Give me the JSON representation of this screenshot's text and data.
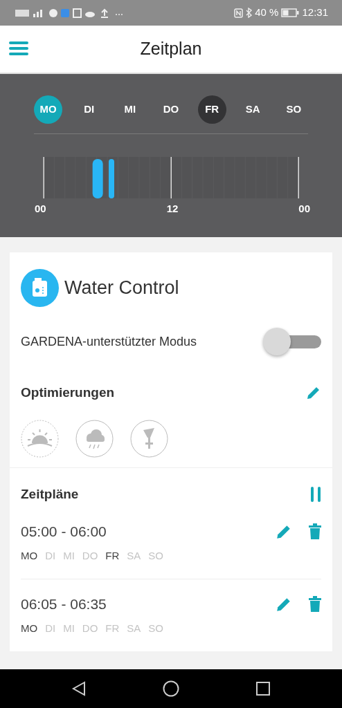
{
  "status_bar": {
    "battery_text": "40 %",
    "time": "12:31"
  },
  "header": {
    "title": "Zeitplan"
  },
  "days": [
    {
      "label": "MO",
      "selected": true,
      "today": false
    },
    {
      "label": "DI",
      "selected": false,
      "today": false
    },
    {
      "label": "MI",
      "selected": false,
      "today": false
    },
    {
      "label": "DO",
      "selected": false,
      "today": false
    },
    {
      "label": "FR",
      "selected": false,
      "today": true
    },
    {
      "label": "SA",
      "selected": false,
      "today": false
    },
    {
      "label": "SO",
      "selected": false,
      "today": false
    }
  ],
  "timeline": {
    "labels": [
      "00",
      "12",
      "00"
    ]
  },
  "device": {
    "name": "Water Control",
    "mode_label": "GARDENA-unterstützter Modus",
    "mode_on": false
  },
  "optimizations": {
    "title": "Optimierungen"
  },
  "schedules": {
    "title": "Zeitpläne",
    "items": [
      {
        "time": "05:00 - 06:00",
        "days": [
          {
            "label": "MO",
            "active": true
          },
          {
            "label": "DI",
            "active": false
          },
          {
            "label": "MI",
            "active": false
          },
          {
            "label": "DO",
            "active": false
          },
          {
            "label": "FR",
            "active": true
          },
          {
            "label": "SA",
            "active": false
          },
          {
            "label": "SO",
            "active": false
          }
        ]
      },
      {
        "time": "06:05 - 06:35",
        "days": [
          {
            "label": "MO",
            "active": true
          },
          {
            "label": "DI",
            "active": false
          },
          {
            "label": "MI",
            "active": false
          },
          {
            "label": "DO",
            "active": false
          },
          {
            "label": "FR",
            "active": false
          },
          {
            "label": "SA",
            "active": false
          },
          {
            "label": "SO",
            "active": false
          }
        ]
      }
    ]
  }
}
